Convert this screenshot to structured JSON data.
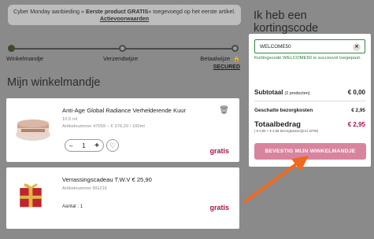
{
  "banner": {
    "text_prefix": "Cyber Monday aanbieding « ",
    "text_bold": "Eerste product GRATIS",
    "text_suffix": "» toegevoegd op het eerste artikel.",
    "link": "Actievoorwaarden"
  },
  "progress": {
    "steps": [
      {
        "label": "Winkelmandje",
        "state": "active"
      },
      {
        "label": "Verzendwijze",
        "state": "inactive"
      },
      {
        "label": "Betaalwijze",
        "sub": "SECURED",
        "state": "inactive"
      }
    ]
  },
  "cart": {
    "title": "Mijn winkelmandje",
    "items": [
      {
        "name": "Anti-Age Global Radiance Verhelderende Kuur",
        "size": "10.5 ml",
        "sku": "Artikelnummer 47059 – € 376,20 / 100ml",
        "qty": "1",
        "minus": "–",
        "plus": "+",
        "price": "gratis"
      },
      {
        "name": "Verrassingscadeau T.W.V € 25,90",
        "sku": "Artikelnummer BG216",
        "qty_text": "Aantal : 1",
        "price": "gratis"
      }
    ]
  },
  "coupon": {
    "title_line1": "Ik heb een",
    "title_line2": "kortingscode",
    "value": "WELCOME50",
    "clear": "✕",
    "success": "Kortingscode WELCOME50 is succesvol toegepast."
  },
  "summary": {
    "subtotal_label": "Subtotaal",
    "subtotal_note": "(2 producten)",
    "subtotal_value": "€ 0,00",
    "shipping_label": "Geschatte bezorgkosten",
    "shipping_value": "€ 2,95",
    "total_label": "Totaalbedrag",
    "total_value": "€ 2,95",
    "total_note": "( € 0,00 + € 2,95 bezorgkosten)(incl. BTW)",
    "confirm": "BEVESTIG MIJN WINKELMANDJE"
  },
  "icons": {
    "trash": "trash-icon",
    "heart": "heart-icon",
    "lock": "lock-icon"
  },
  "colors": {
    "accent": "#a8164f",
    "button": "#d9849f",
    "success": "#2e7d3c",
    "arrow": "#f06a1d"
  }
}
